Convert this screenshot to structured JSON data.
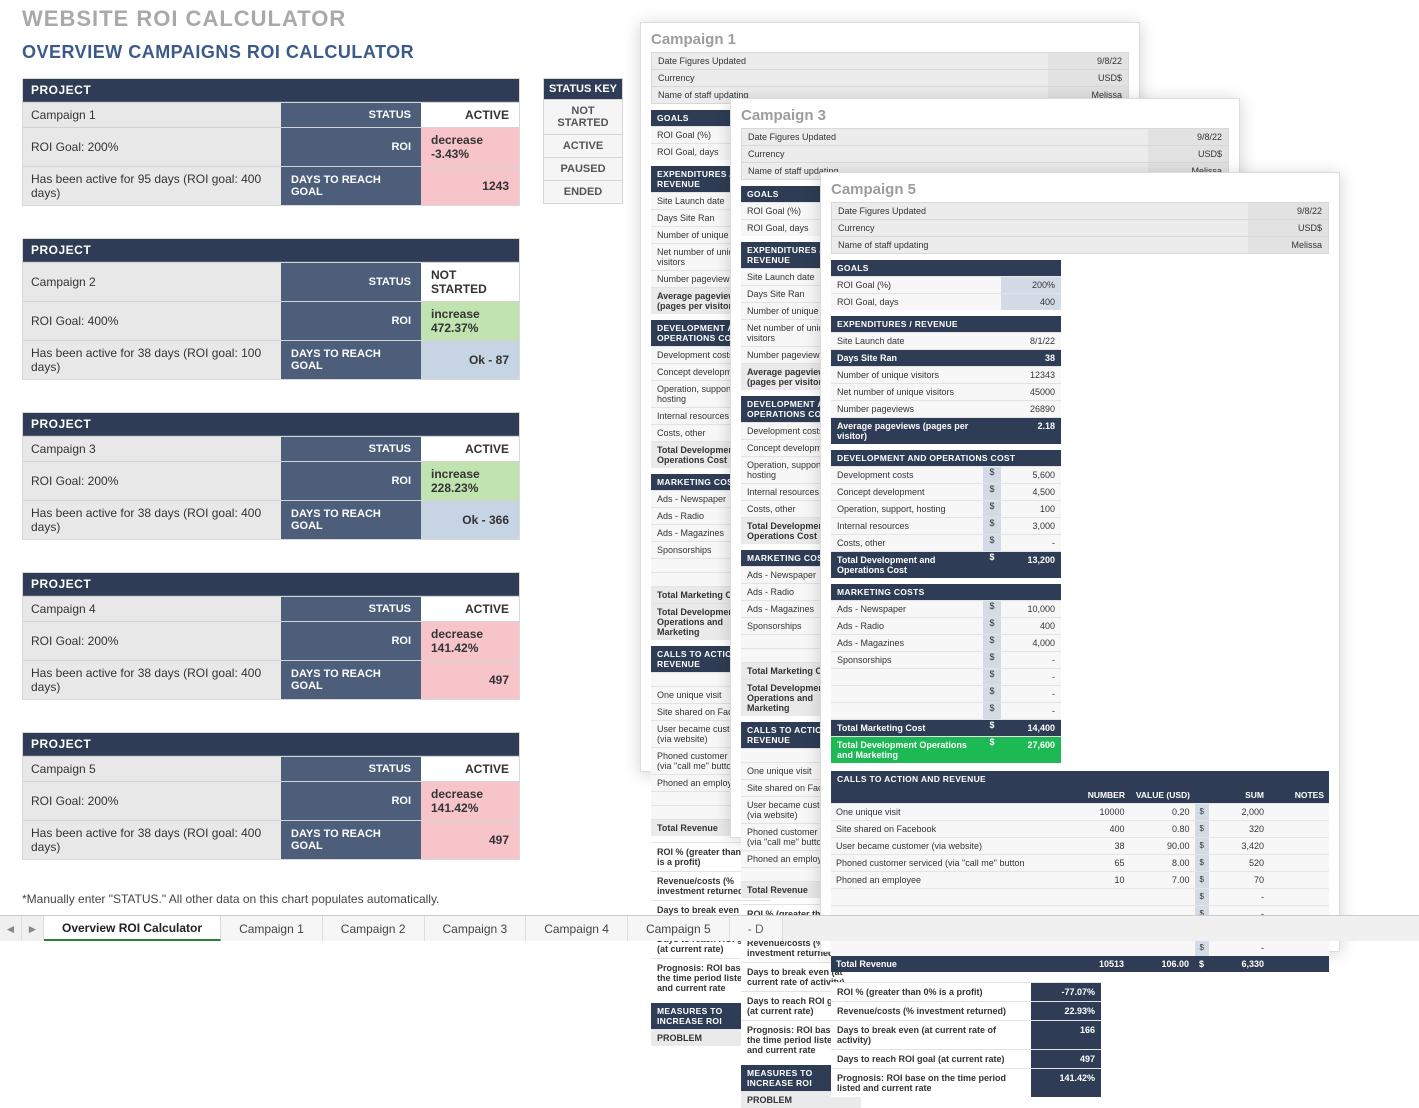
{
  "title": "WEBSITE ROI CALCULATOR",
  "subtitle": "OVERVIEW CAMPAIGNS ROI CALCULATOR",
  "labels": {
    "project": "PROJECT",
    "status": "STATUS",
    "roi": "ROI",
    "days": "DAYS TO REACH GOAL"
  },
  "projects": [
    {
      "name": "Campaign 1",
      "status": "ACTIVE",
      "roi_goal_line": "ROI Goal:  200%",
      "roi": "decrease -3.43%",
      "roi_shade": "c-pink",
      "active_line": "Has been active for 95 days (ROI goal: 400 days)",
      "days": "1243",
      "days_shade": "c-pink"
    },
    {
      "name": "Campaign 2",
      "status": "NOT STARTED",
      "roi_goal_line": "ROI Goal:  400%",
      "roi": "increase 472.37%",
      "roi_shade": "c-green",
      "active_line": "Has been active for 38 days (ROI goal: 100 days)",
      "days": "Ok - 87",
      "days_shade": "c-blue"
    },
    {
      "name": "Campaign 3",
      "status": "ACTIVE",
      "roi_goal_line": "ROI Goal:  200%",
      "roi": "increase 228.23%",
      "roi_shade": "c-green",
      "active_line": "Has been active for 38 days (ROI goal: 400 days)",
      "days": "Ok - 366",
      "days_shade": "c-blue"
    },
    {
      "name": "Campaign 4",
      "status": "ACTIVE",
      "roi_goal_line": "ROI Goal:  200%",
      "roi": "decrease 141.42%",
      "roi_shade": "c-pink",
      "active_line": "Has been active for 38 days (ROI goal: 400 days)",
      "days": "497",
      "days_shade": "c-pink"
    },
    {
      "name": "Campaign 5",
      "status": "ACTIVE",
      "roi_goal_line": "ROI Goal:  200%",
      "roi": "decrease 141.42%",
      "roi_shade": "c-pink",
      "active_line": "Has been active for 38 days (ROI goal: 400 days)",
      "days": "497",
      "days_shade": "c-pink"
    }
  ],
  "footnote": "*Manually enter \"STATUS.\" All other data on this chart populates automatically.",
  "status_key": {
    "header": "STATUS KEY",
    "items": [
      "NOT STARTED",
      "ACTIVE",
      "PAUSED",
      "ENDED"
    ]
  },
  "preview_shared": {
    "meta_labels": {
      "date": "Date Figures Updated",
      "currency": "Currency",
      "staff": "Name of staff updating"
    },
    "goals_header": "GOALS",
    "goals_labels": {
      "pct": "ROI Goal (%)",
      "days": "ROI Goal, days"
    },
    "exp_header": "EXPENDITURES / REVENUE",
    "exp_labels": [
      "Site Launch date",
      "Days Site Ran",
      "Number of unique visitors",
      "Net number of unique visitors",
      "Number pageviews",
      "Average pageviews (pages per visitor)"
    ],
    "dev_header": "DEVELOPMENT AND OPERATIONS COST",
    "dev_labels": [
      "Development costs",
      "Concept development",
      "Operation, support, hosting",
      "Internal resources",
      "Costs, other",
      "Total Development and Operations Cost"
    ],
    "mkt_header": "MARKETING COSTS",
    "mkt_labels": [
      "Ads - Newspaper",
      "Ads - Radio",
      "Ads - Magazines",
      "Sponsorships"
    ],
    "mkt_totals": [
      "Total Marketing Cost",
      "Total Development Operations and Marketing"
    ],
    "cta_header": "CALLS TO ACTION AND REVENUE",
    "cta_cols": [
      "NUMBER",
      "VALUE (USD)",
      "SUM",
      "NOTES"
    ],
    "cta_labels": [
      "One unique visit",
      "Site shared on Facebook",
      "User became customer (via website)",
      "Phoned customer serviced (via \"call me\" button",
      "Phoned an employee"
    ],
    "total_revenue": "Total Revenue",
    "result_labels": [
      "ROI % (greater than 0% is a profit)",
      "Revenue/costs (% investment returned)",
      "Days to break even (at current rate of activity)",
      "Days to reach ROI goal (at current rate)",
      "Prognosis: ROI base on the time period listed and current rate"
    ],
    "measures_header": "MEASURES TO INCREASE ROI",
    "problem": "PROBLEM"
  },
  "preview1": {
    "title": "Campaign 1",
    "meta": {
      "date": "9/8/22",
      "currency": "USD$",
      "staff": "Melissa"
    }
  },
  "preview3": {
    "title": "Campaign 3",
    "meta": {
      "date": "9/8/22",
      "currency": "USD$",
      "staff": "Melissa"
    }
  },
  "preview5": {
    "title": "Campaign 5",
    "meta": {
      "date": "9/8/22",
      "currency": "USD$",
      "staff": "Melissa"
    },
    "goals": {
      "pct": "200%",
      "days": "400"
    },
    "exp": {
      "launch": "8/1/22",
      "days_ran": "38",
      "unique": "12343",
      "net_unique": "45000",
      "pageviews": "26890",
      "avg_pv": "2.18"
    },
    "dev": {
      "dev": "5,600",
      "concept": "4,500",
      "ops": "100",
      "internal": "3,000",
      "other": "-",
      "total": "13,200"
    },
    "mkt": {
      "news": "10,000",
      "radio": "400",
      "mags": "4,000",
      "spons": "-",
      "blank": "-",
      "total": "14,400",
      "grand": "27,600"
    },
    "cta": [
      {
        "d": "One unique visit",
        "n": "10000",
        "v": "0.20",
        "s": "2,000"
      },
      {
        "d": "Site shared on Facebook",
        "n": "400",
        "v": "0.80",
        "s": "320"
      },
      {
        "d": "User became customer (via website)",
        "n": "38",
        "v": "90.00",
        "s": "3,420"
      },
      {
        "d": "Phoned customer serviced (via \"call me\" button",
        "n": "65",
        "v": "8.00",
        "s": "520"
      },
      {
        "d": "Phoned an employee",
        "n": "10",
        "v": "7.00",
        "s": "70"
      }
    ],
    "cta_blanks": [
      "-",
      "-",
      "-",
      "-"
    ],
    "cta_total": {
      "n": "10513",
      "v": "106.00",
      "s": "6,330"
    },
    "results": {
      "roi_pct": "-77.07%",
      "rev_cost": "22.93%",
      "break_even": "166",
      "reach_goal": "497",
      "prognosis": "141.42%"
    }
  },
  "tabs": [
    "Overview ROI Calculator",
    "Campaign 1",
    "Campaign 2",
    "Campaign 3",
    "Campaign 4",
    "Campaign 5",
    "- D"
  ]
}
